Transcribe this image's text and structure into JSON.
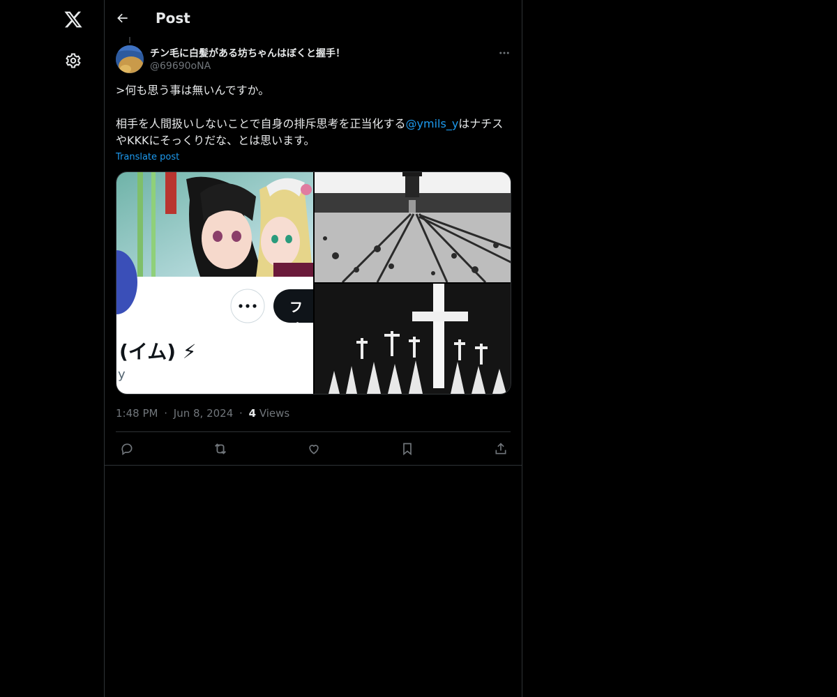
{
  "nav": {
    "logo_icon": "x-logo-icon",
    "settings_icon": "gear-icon"
  },
  "header": {
    "title": "Post",
    "back_icon": "arrow-left-icon"
  },
  "post": {
    "display_name": "チン毛に白髪がある坊ちゃんはぼくと握手！",
    "handle": "@69690oNA",
    "text_line1": ">何も思う事は無いんですか。",
    "text_line2_before": "相手を人間扱いしないことで自身の排斥思考を正当化する",
    "mention": "@ymils_y",
    "text_line2_after": "はナチスやKKKにそっくりだな、とは思います。",
    "translate_label": "Translate post",
    "media": {
      "image1_label": "(イム) ⚡",
      "image1_button_partial": "フォ",
      "image1_handle_fragment": "y"
    },
    "time": "1:48 PM",
    "separator": "·",
    "date": "Jun 8, 2024",
    "views_count": "4",
    "views_label": "Views"
  },
  "actions": [
    {
      "name": "reply",
      "icon": "reply-icon"
    },
    {
      "name": "repost",
      "icon": "repost-icon"
    },
    {
      "name": "like",
      "icon": "heart-icon"
    },
    {
      "name": "bookmark",
      "icon": "bookmark-icon"
    },
    {
      "name": "share",
      "icon": "share-icon"
    }
  ],
  "colors": {
    "background": "#000000",
    "text_primary": "#e7e9ea",
    "text_secondary": "#71767b",
    "accent": "#1d9bf0",
    "border": "#2f3336"
  }
}
